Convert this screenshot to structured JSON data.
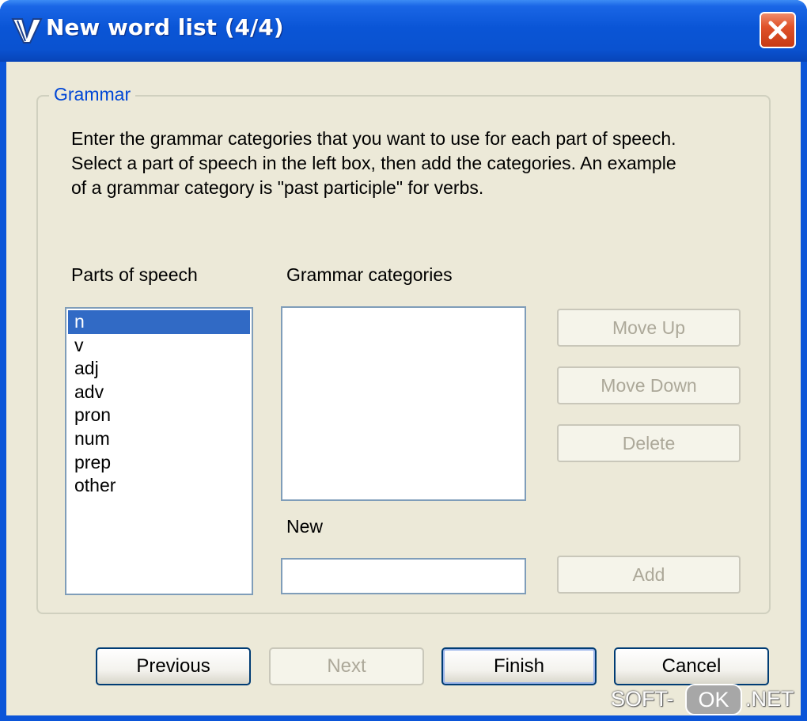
{
  "window": {
    "title": "New word list (4/4)",
    "icon": "v-logo-icon",
    "close_icon": "close-icon"
  },
  "group": {
    "legend": "Grammar",
    "description_lines": [
      "Enter the grammar categories that you want to use for each part of speech.",
      "Select a part of speech in the left box, then add the categories.  An example",
      "of a grammar category is \"past participle\" for verbs."
    ]
  },
  "parts_of_speech": {
    "label": "Parts of speech",
    "items": [
      "n",
      "v",
      "adj",
      "adv",
      "pron",
      "num",
      "prep",
      "other"
    ],
    "selected": "n"
  },
  "grammar_categories": {
    "label": "Grammar categories",
    "items": []
  },
  "new_field": {
    "label": "New",
    "value": ""
  },
  "side_buttons": {
    "move_up": "Move Up",
    "move_down": "Move Down",
    "delete": "Delete",
    "add": "Add"
  },
  "nav_buttons": {
    "previous": "Previous",
    "next": "Next",
    "finish": "Finish",
    "cancel": "Cancel"
  },
  "watermark": {
    "left": "SOFT-",
    "middle": "OK",
    "right": ".NET"
  },
  "colors": {
    "titlebar": "#0a55d6",
    "dialog_bg": "#ece9d8",
    "selection": "#316ac5",
    "group_legend": "#0046d5",
    "disabled_text": "#aca899"
  }
}
